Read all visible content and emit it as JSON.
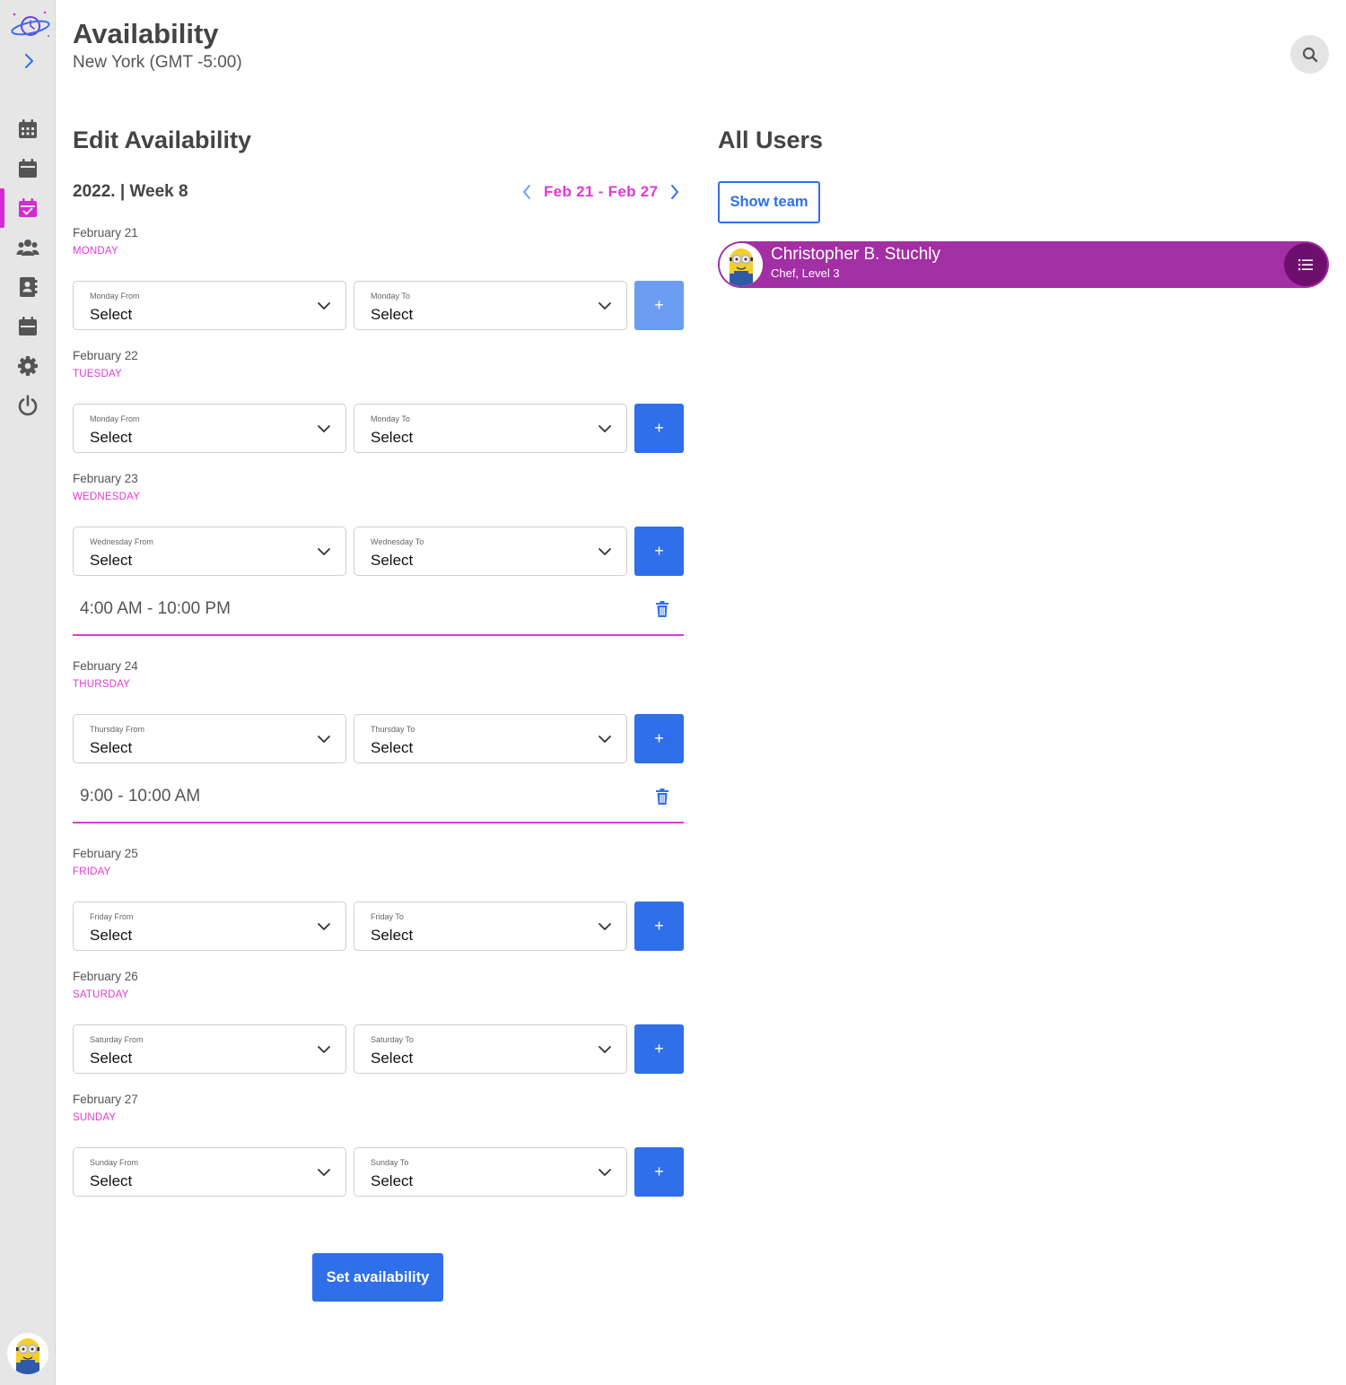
{
  "header": {
    "title": "Availability",
    "subtitle": "New York (GMT -5:00)"
  },
  "edit": {
    "title": "Edit Availability",
    "week_label": "2022. | Week 8",
    "week_range": "Feb 21 - Feb 27",
    "add_label": "+",
    "submit_label": "Set availability"
  },
  "days": [
    {
      "date": "February 21",
      "name": "MONDAY",
      "from_label": "Monday From",
      "to_label": "Monday To",
      "from_value": "Select",
      "to_value": "Select"
    },
    {
      "date": "February 22",
      "name": "TUESDAY",
      "from_label": "Monday From",
      "to_label": "Monday To",
      "from_value": "Select",
      "to_value": "Select"
    },
    {
      "date": "February 23",
      "name": "WEDNESDAY",
      "from_label": "Wednesday From",
      "to_label": "Wednesday To",
      "from_value": "Select",
      "to_value": "Select",
      "slot": "4:00 AM - 10:00 PM"
    },
    {
      "date": "February 24",
      "name": "THURSDAY",
      "from_label": "Thursday From",
      "to_label": "Thursday To",
      "from_value": "Select",
      "to_value": "Select",
      "slot": "9:00 - 10:00 AM"
    },
    {
      "date": "February 25",
      "name": "FRIDAY",
      "from_label": "Friday From",
      "to_label": "Friday To",
      "from_value": "Select",
      "to_value": "Select"
    },
    {
      "date": "February 26",
      "name": "SATURDAY",
      "from_label": "Saturday From",
      "to_label": "Saturday To",
      "from_value": "Select",
      "to_value": "Select"
    },
    {
      "date": "February 27",
      "name": "SUNDAY",
      "from_label": "Sunday From",
      "to_label": "Sunday To",
      "from_value": "Select",
      "to_value": "Select"
    }
  ],
  "users": {
    "title": "All Users",
    "show_team_label": "Show team",
    "list": [
      {
        "name": "Christopher B. Stuchly",
        "role": "Chef, Level 3"
      }
    ]
  },
  "sidebar": {
    "items": [
      {
        "icon": "calendar-grid-icon"
      },
      {
        "icon": "calendar-icon"
      },
      {
        "icon": "calendar-check-icon",
        "active": true
      },
      {
        "icon": "users-icon"
      },
      {
        "icon": "contact-book-icon"
      },
      {
        "icon": "calendar-alt-icon"
      },
      {
        "icon": "gear-icon"
      },
      {
        "icon": "power-icon"
      }
    ]
  },
  "colors": {
    "accent_pink": "#e03ad6",
    "primary_blue": "#2f6fe9",
    "user_card": "#a22fa3",
    "user_menu": "#6e0f6e"
  }
}
